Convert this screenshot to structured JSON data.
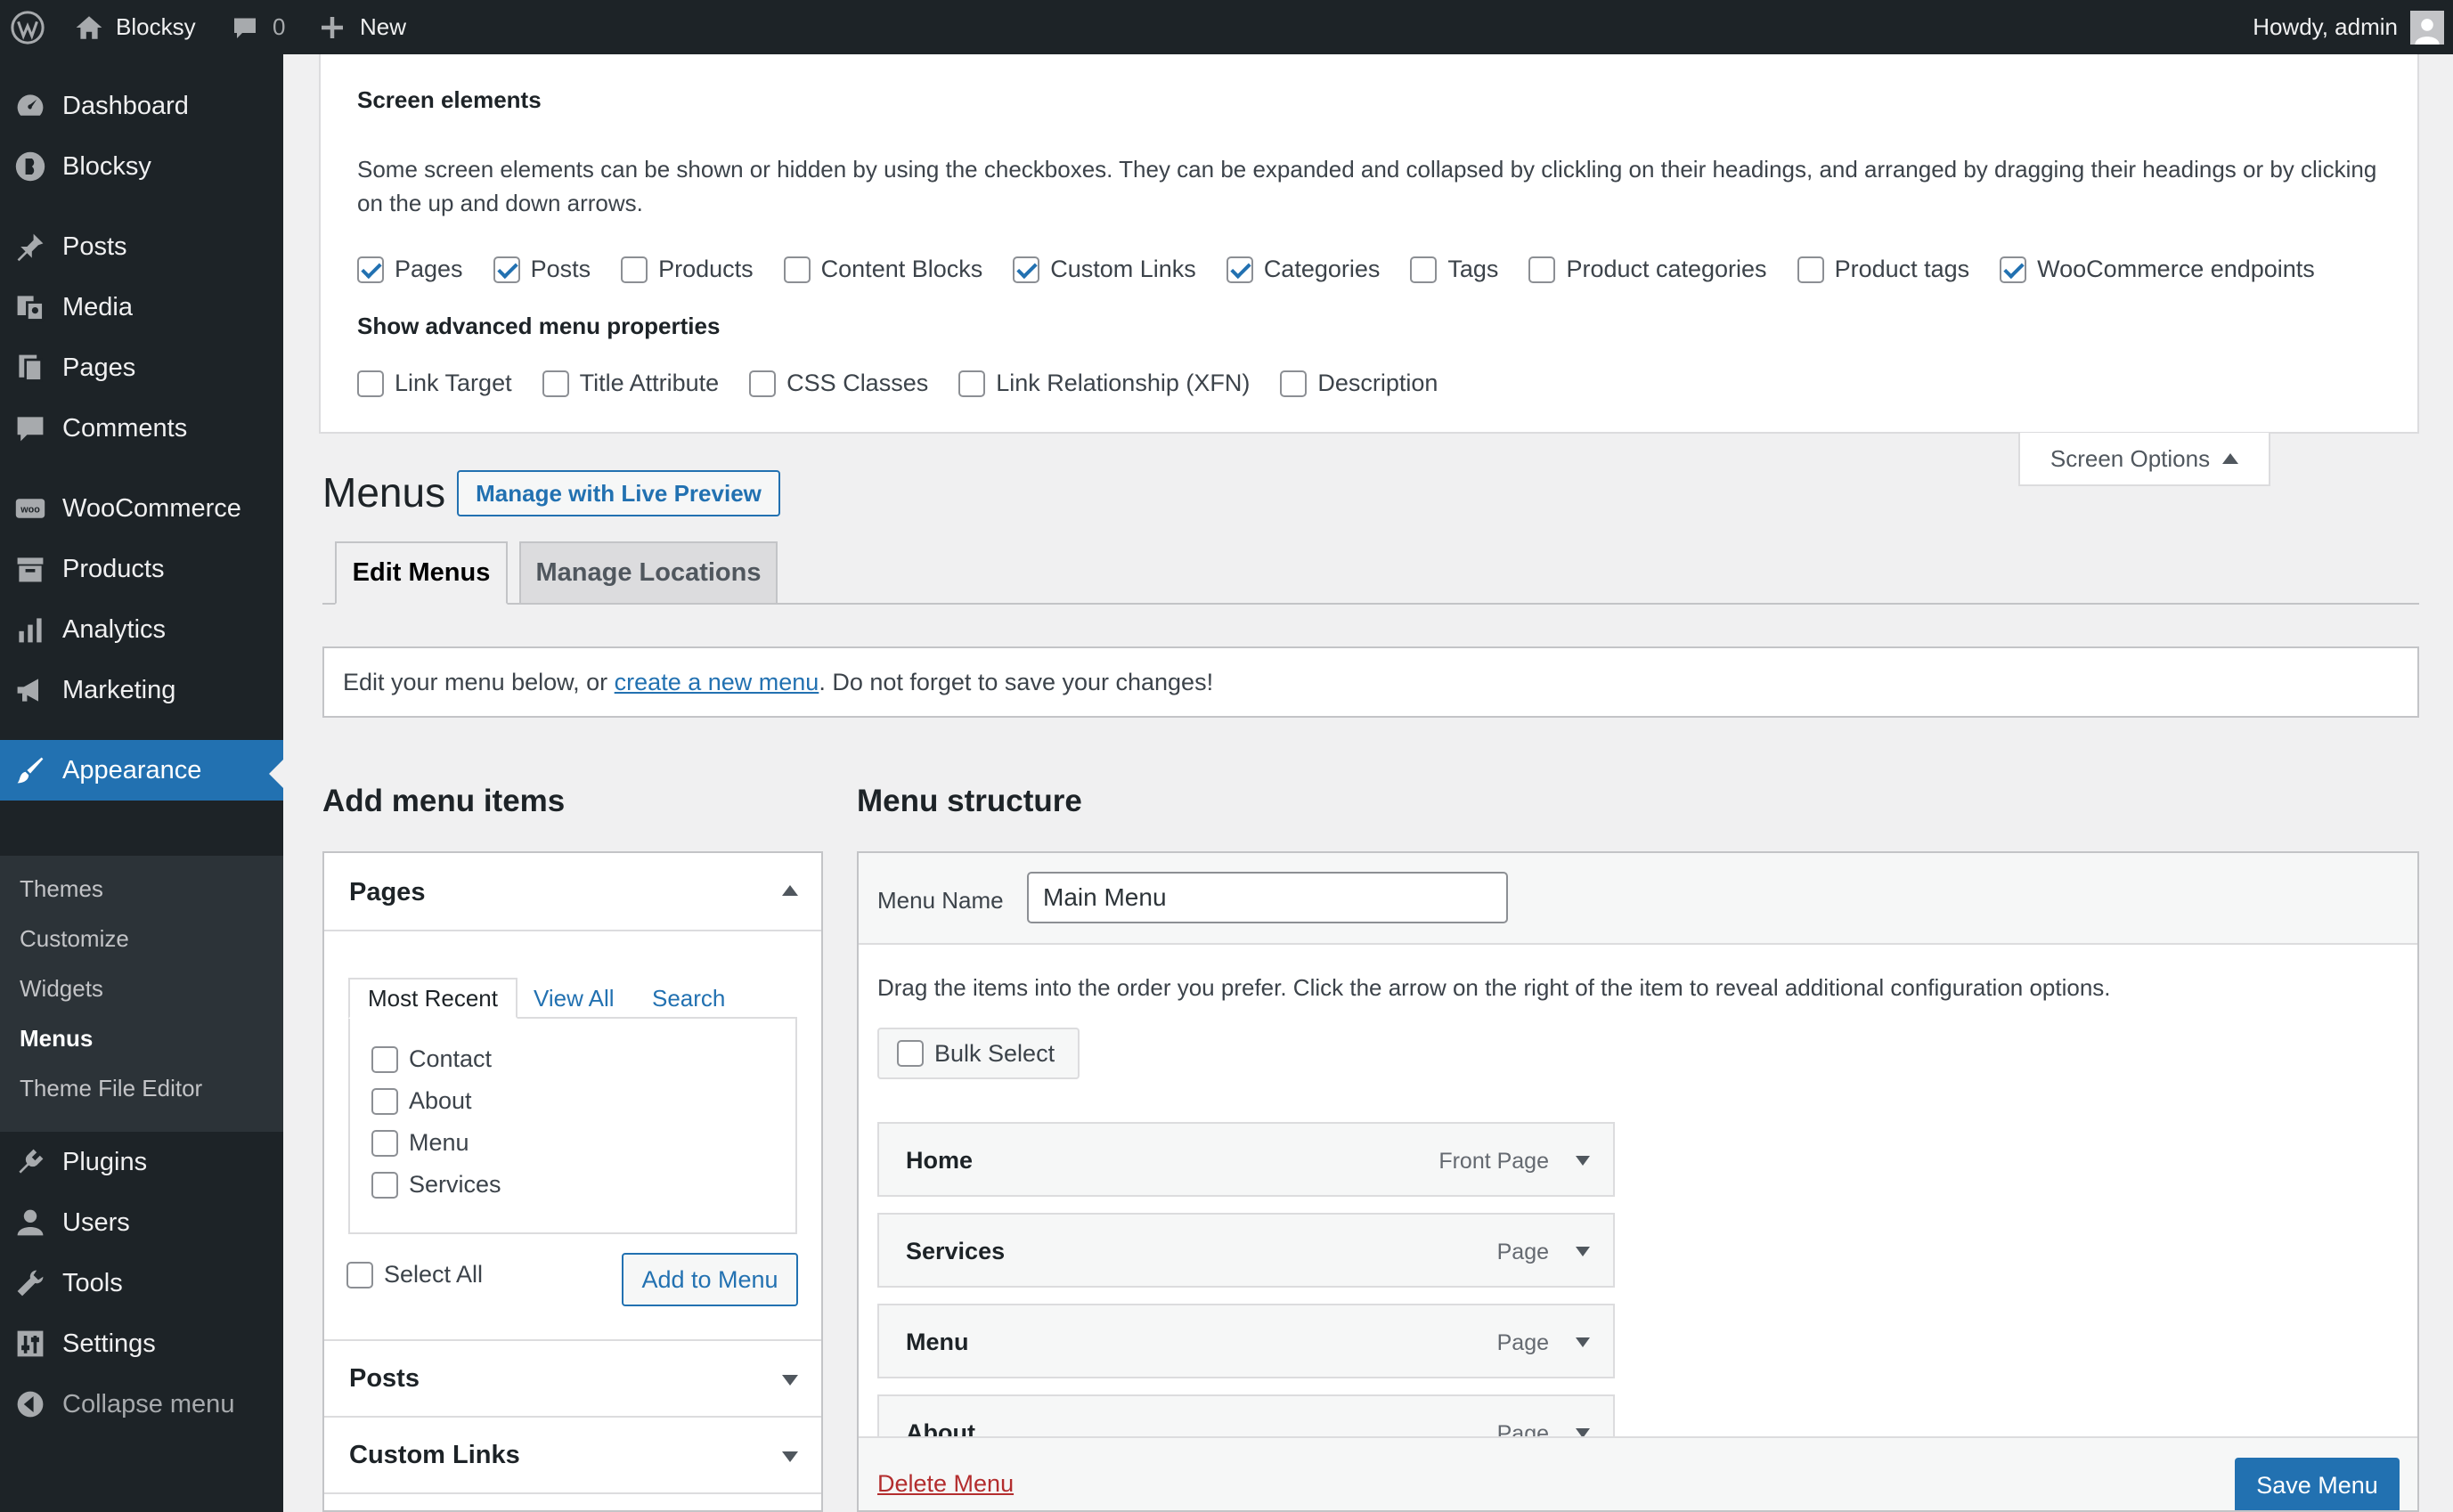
{
  "admin_bar": {
    "site_name": "Blocksy",
    "comments_count": "0",
    "new_label": "New",
    "greeting": "Howdy, admin",
    "icons": [
      "wordpress-logo-icon",
      "home-icon",
      "comment-icon",
      "plus-icon",
      "avatar"
    ]
  },
  "sidebar": {
    "items": [
      {
        "label": "Dashboard",
        "icon": "dashboard-icon"
      },
      {
        "label": "Blocksy",
        "icon": "blocksy-icon"
      },
      {
        "label": "Posts",
        "icon": "pin-icon"
      },
      {
        "label": "Media",
        "icon": "media-icon"
      },
      {
        "label": "Pages",
        "icon": "pages-icon"
      },
      {
        "label": "Comments",
        "icon": "comment-icon"
      },
      {
        "label": "WooCommerce",
        "icon": "woo-icon"
      },
      {
        "label": "Products",
        "icon": "archive-icon"
      },
      {
        "label": "Analytics",
        "icon": "bar-chart-icon"
      },
      {
        "label": "Marketing",
        "icon": "megaphone-icon"
      },
      {
        "label": "Appearance",
        "icon": "brush-icon"
      },
      {
        "label": "Plugins",
        "icon": "plug-icon"
      },
      {
        "label": "Users",
        "icon": "user-icon"
      },
      {
        "label": "Tools",
        "icon": "wrench-icon"
      },
      {
        "label": "Settings",
        "icon": "sliders-icon"
      },
      {
        "label": "Collapse menu",
        "icon": "collapse-icon"
      }
    ],
    "submenu": [
      "Themes",
      "Customize",
      "Widgets",
      "Menus",
      "Theme File Editor"
    ]
  },
  "screen_options": {
    "heading": "Screen elements",
    "description": "Some screen elements can be shown or hidden by using the checkboxes. They can be expanded and collapsed by clickling on their headings, and arranged by dragging their headings or by clicking on the up and down arrows.",
    "elements": [
      {
        "label": "Pages",
        "checked": true
      },
      {
        "label": "Posts",
        "checked": true
      },
      {
        "label": "Products",
        "checked": false
      },
      {
        "label": "Content Blocks",
        "checked": false
      },
      {
        "label": "Custom Links",
        "checked": true
      },
      {
        "label": "Categories",
        "checked": true
      },
      {
        "label": "Tags",
        "checked": false
      },
      {
        "label": "Product categories",
        "checked": false
      },
      {
        "label": "Product tags",
        "checked": false
      },
      {
        "label": "WooCommerce endpoints",
        "checked": true
      }
    ],
    "advanced_heading": "Show advanced menu properties",
    "advanced": [
      {
        "label": "Link Target",
        "checked": false
      },
      {
        "label": "Title Attribute",
        "checked": false
      },
      {
        "label": "CSS Classes",
        "checked": false
      },
      {
        "label": "Link Relationship (XFN)",
        "checked": false
      },
      {
        "label": "Description",
        "checked": false
      }
    ],
    "tab_label": "Screen Options"
  },
  "page": {
    "title": "Menus",
    "live_preview_label": "Manage with Live Preview",
    "tabs": [
      "Edit Menus",
      "Manage Locations"
    ],
    "notice": {
      "before": "Edit your menu below, or ",
      "link": "create a new menu",
      "after": ". Do not forget to save your changes!"
    }
  },
  "add_items": {
    "heading": "Add menu items",
    "pages_title": "Pages",
    "subtabs": [
      "Most Recent",
      "View All",
      "Search"
    ],
    "pages": [
      "Contact",
      "About",
      "Menu",
      "Services"
    ],
    "select_all_label": "Select All",
    "add_button_label": "Add to Menu",
    "sections": [
      "Posts",
      "Custom Links"
    ]
  },
  "structure": {
    "heading": "Menu structure",
    "menu_name_label": "Menu Name",
    "menu_name_value": "Main Menu",
    "instructions": "Drag the items into the order you prefer. Click the arrow on the right of the item to reveal additional configuration options.",
    "bulk_select_label": "Bulk Select",
    "items": [
      {
        "title": "Home",
        "type": "Front Page"
      },
      {
        "title": "Services",
        "type": "Page"
      },
      {
        "title": "Menu",
        "type": "Page"
      },
      {
        "title": "About",
        "type": "Page"
      }
    ],
    "delete_label": "Delete Menu",
    "save_label": "Save Menu"
  },
  "colors": {
    "accent": "#2271b1",
    "sidebar": "#1d2327",
    "delete": "#b32d2e"
  }
}
